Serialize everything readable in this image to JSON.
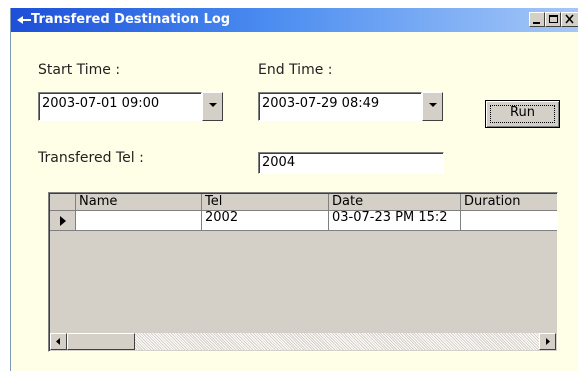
{
  "window": {
    "title": "Transfered Destination Log",
    "minimize_label": "_",
    "maximize_label": "□",
    "close_label": "×"
  },
  "form": {
    "start_time_label": "Start Time :",
    "start_time_value": "2003-07-01 09:00",
    "end_time_label": "End Time :",
    "end_time_value": "2003-07-29 08:49",
    "run_label": "Run",
    "transfered_tel_label": "Transfered Tel :",
    "transfered_tel_value": "2004"
  },
  "grid": {
    "columns": [
      "Name",
      "Tel",
      "Date",
      "Duration"
    ],
    "rows": [
      {
        "name": "",
        "tel": "2002",
        "date": "03-07-23 PM 15:2",
        "duration": ""
      }
    ]
  },
  "colors": {
    "titlebar_start": "#1d4fd8",
    "titlebar_end": "#a6c8f8",
    "window_bg": "#ffffe8",
    "control_face": "#d4d0c8"
  }
}
